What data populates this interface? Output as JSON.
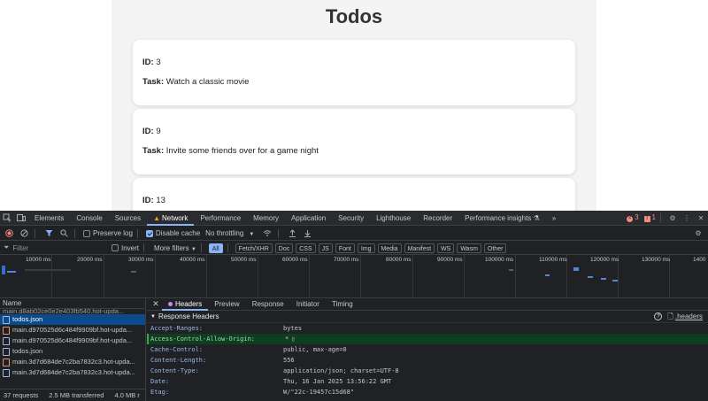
{
  "page": {
    "title": "Todos",
    "todos": [
      {
        "id_label": "ID:",
        "id": "3",
        "task_label": "Task:",
        "task": "Watch a classic movie"
      },
      {
        "id_label": "ID:",
        "id": "9",
        "task_label": "Task:",
        "task": "Invite some friends over for a game night"
      },
      {
        "id_label": "ID:",
        "id": "13",
        "task_label": "",
        "task": ""
      }
    ]
  },
  "devtools": {
    "tabs": [
      "Elements",
      "Console",
      "Sources",
      "Network",
      "Performance",
      "Memory",
      "Application",
      "Security",
      "Lighthouse",
      "Recorder",
      "Performance insights"
    ],
    "active_tab": "Network",
    "more_tabs": "»",
    "error_count": "3",
    "warning_count": "1",
    "toolbar": {
      "preserve_log": "Preserve log",
      "disable_cache": "Disable cache",
      "throttling": "No throttling"
    },
    "filter": {
      "placeholder": "Filter",
      "invert": "Invert",
      "more_filters": "More filters",
      "chips": [
        "All",
        "Fetch/XHR",
        "Doc",
        "CSS",
        "JS",
        "Font",
        "Img",
        "Media",
        "Manifest",
        "WS",
        "Wasm",
        "Other"
      ]
    },
    "timeline_ticks": [
      "10000 ms",
      "20000 ms",
      "30000 ms",
      "40000 ms",
      "50000 ms",
      "60000 ms",
      "70000 ms",
      "80000 ms",
      "90000 ms",
      "100000 ms",
      "110000 ms",
      "120000 ms",
      "130000 ms",
      "1400"
    ],
    "requests": {
      "header": "Name",
      "partial_row": "main.d8ab02ce0e2e403fb540.hot-upda...",
      "rows": [
        {
          "name": "todos.json",
          "type": "json",
          "selected": true
        },
        {
          "name": "main.d970525d6c484f9909bf.hot-upda...",
          "type": "html",
          "selected": false
        },
        {
          "name": "main.d970525d6c484f9909bf.hot-upda...",
          "type": "json",
          "selected": false
        },
        {
          "name": "todos.json",
          "type": "json",
          "selected": false
        },
        {
          "name": "main.3d7d684de7c2ba7832c3.hot-upda...",
          "type": "html",
          "selected": false
        },
        {
          "name": "main.3d7d684de7c2ba7832c3.hot-upda...",
          "type": "json",
          "selected": false
        }
      ],
      "summary": {
        "requests": "37 requests",
        "transferred": "2.5 MB transferred",
        "resources": "4.0 MB r"
      }
    },
    "detail": {
      "close": "✕",
      "tabs": [
        "Headers",
        "Preview",
        "Response",
        "Initiator",
        "Timing"
      ],
      "active_tab": "Headers",
      "section_title": "Response Headers",
      "headers_link": ".headers",
      "response_headers": [
        {
          "key": "Accept-Ranges:",
          "value": "bytes",
          "highlight": false
        },
        {
          "key": "Access-Control-Allow-Origin:",
          "value": "*",
          "highlight": true
        },
        {
          "key": "Cache-Control:",
          "value": "public, max-age=0",
          "highlight": false
        },
        {
          "key": "Content-Length:",
          "value": "556",
          "highlight": false
        },
        {
          "key": "Content-Type:",
          "value": "application/json; charset=UTF-8",
          "highlight": false
        },
        {
          "key": "Date:",
          "value": "Thu, 16 Jan 2025 13:56:22 GMT",
          "highlight": false
        },
        {
          "key": "Etag:",
          "value": "W/\"22c-19457c15d68\"",
          "highlight": false
        }
      ]
    }
  }
}
